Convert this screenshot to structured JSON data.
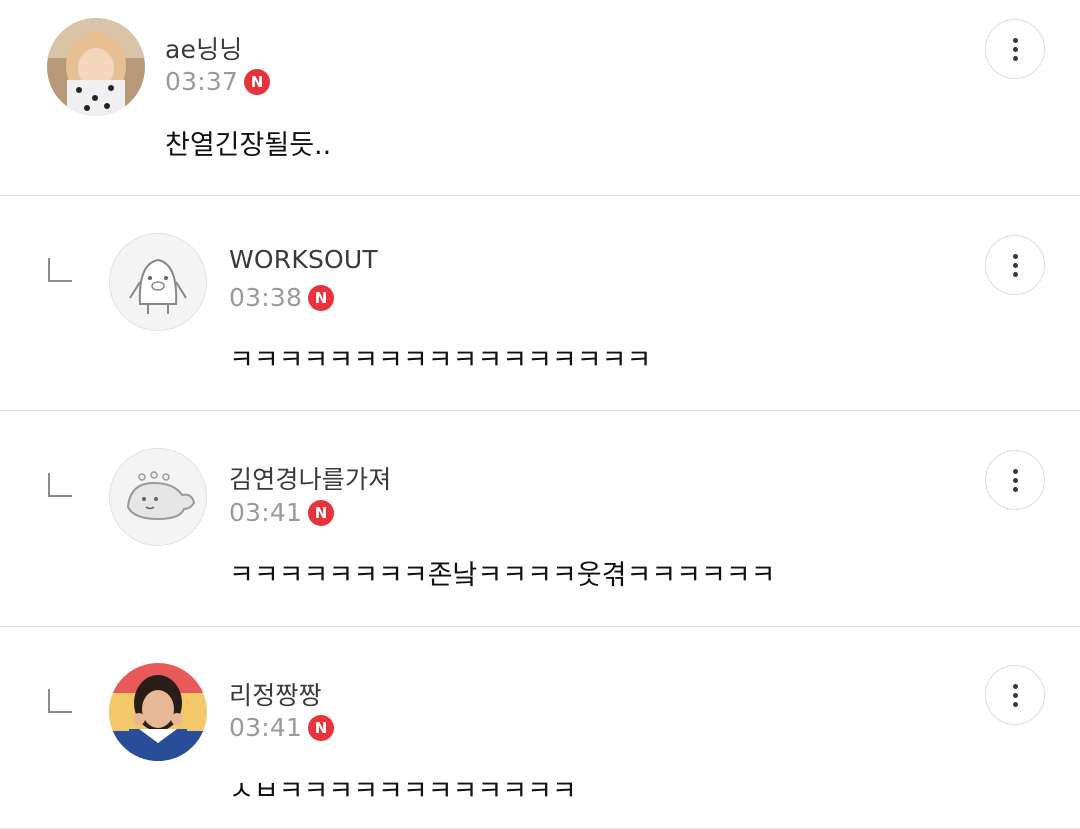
{
  "comments": [
    {
      "author": "ae닝닝",
      "time": "03:37",
      "badge": "N",
      "text": "찬열긴장될듯..",
      "is_reply": false,
      "avatar": "profile-photo"
    },
    {
      "author": "WORKSOUT",
      "time": "03:38",
      "badge": "N",
      "text": "ㅋㅋㅋㅋㅋㅋㅋㅋㅋㅋㅋㅋㅋㅋㅋㅋㅋ",
      "is_reply": true,
      "avatar": "default-pig-avatar"
    },
    {
      "author": "김연경나를가져",
      "time": "03:41",
      "badge": "N",
      "text": "ㅋㅋㅋㅋㅋㅋㅋㅋ존낰ㅋㅋㅋㅋ웃겪ㅋㅋㅋㅋㅋㅋ",
      "is_reply": true,
      "avatar": "default-dino-avatar"
    },
    {
      "author": "리정짱짱",
      "time": "03:41",
      "badge": "N",
      "text": "ㅅㅂㅋㅋㅋㅋㅋㅋㅋㅋㅋㅋㅋㅋ",
      "is_reply": true,
      "avatar": "profile-photo"
    }
  ],
  "colors": {
    "badge": "#e8333d",
    "divider": "#e3e3e3",
    "time_text": "#9a9a9a"
  },
  "icons": {
    "more": "more-vertical-icon",
    "reply": "reply-indicator-icon"
  }
}
